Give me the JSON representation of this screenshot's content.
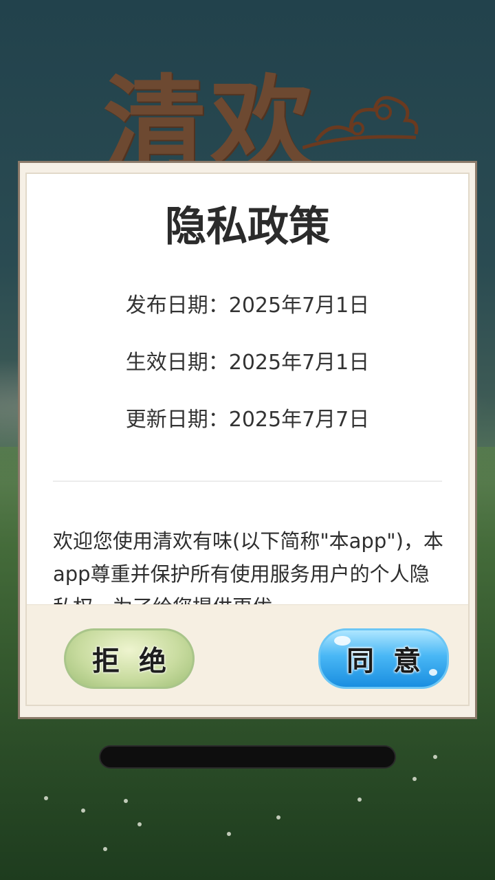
{
  "background": {
    "logo_text": "清欢"
  },
  "dialog": {
    "title": "隐私政策",
    "dates": [
      {
        "text": "发布日期：2025年7月1日"
      },
      {
        "text": "生效日期：2025年7月1日"
      },
      {
        "text": "更新日期：2025年7月7日"
      }
    ],
    "policy_text": "欢迎您使用清欢有味(以下简称\"本app\")，本app尊重并保护所有使用服务用户的个人隐私权。为了给您提供更优",
    "reject_label": "拒绝",
    "agree_label": "同意"
  },
  "loading": {
    "progress": 0
  },
  "colors": {
    "reject_button": "#c9dca0",
    "agree_button": "#49b7f5",
    "dialog_border": "#8b7a6a"
  }
}
